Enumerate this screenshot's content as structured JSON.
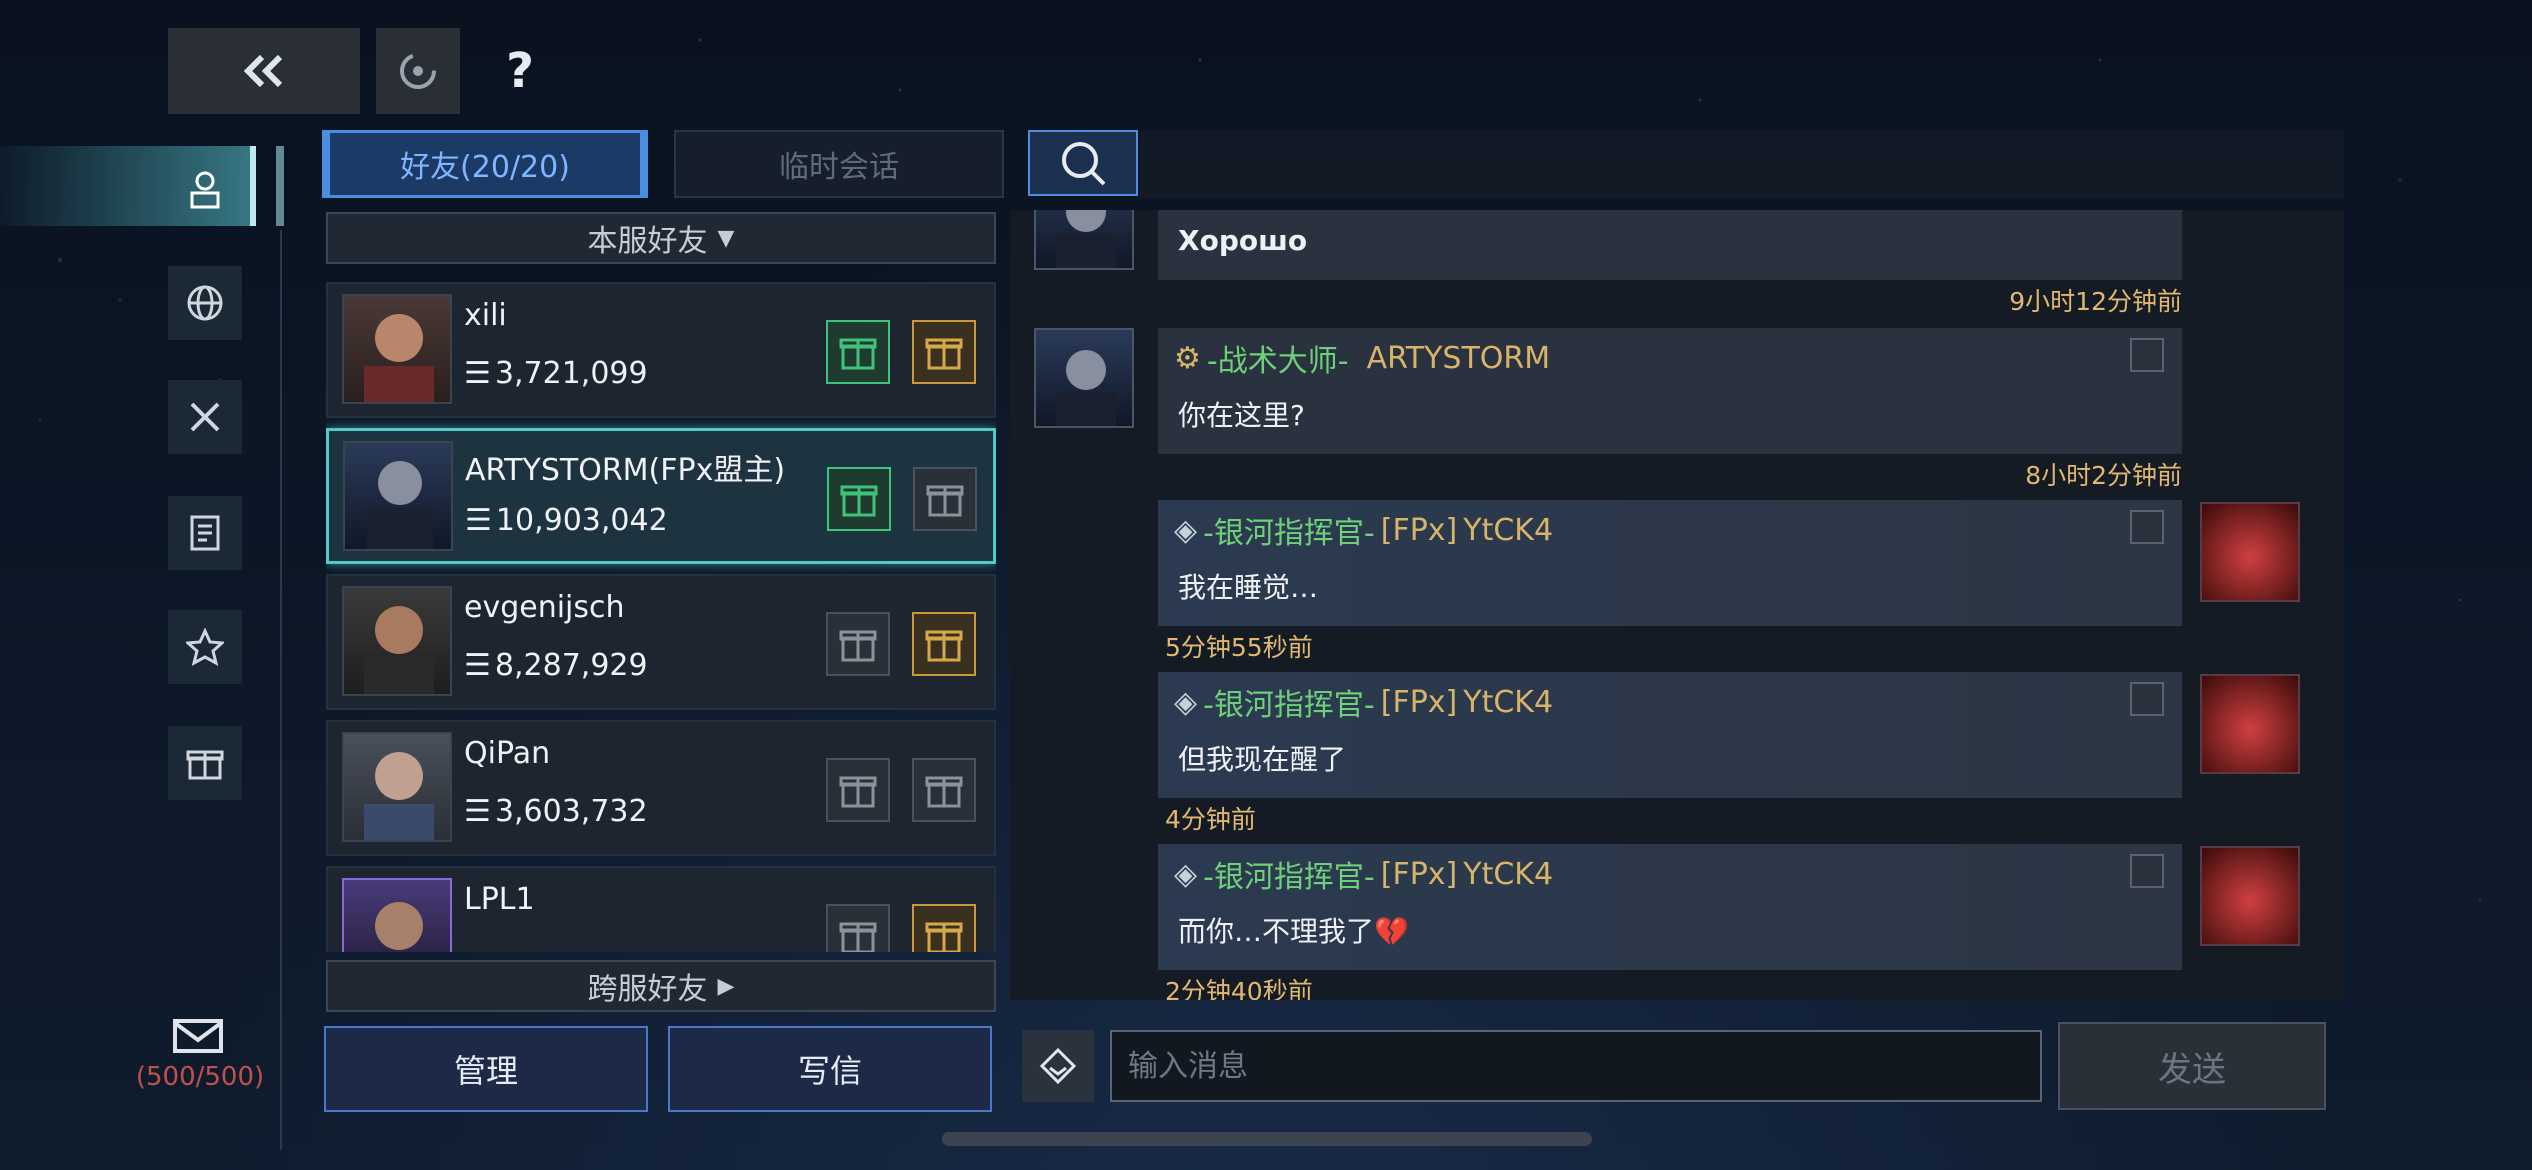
{
  "header": {
    "back_icon": "double-chevron-left-icon",
    "refresh_icon": "refresh-icon",
    "help_label": "?"
  },
  "rail": {
    "items": [
      {
        "icon": "person-icon",
        "active": true
      },
      {
        "icon": "globe-icon"
      },
      {
        "icon": "crossed-swords-icon"
      },
      {
        "icon": "document-icon"
      },
      {
        "icon": "star-icon"
      },
      {
        "icon": "gift-icon"
      }
    ],
    "mail_icon": "envelope-icon",
    "mail_count": "(500/500)"
  },
  "tabs": {
    "friends": "好友(20/20)",
    "temp_chat": "临时会话"
  },
  "friends": {
    "local_header": "本服好友",
    "cross_header": "跨服好友",
    "list": [
      {
        "name": "xili",
        "power": "3,721,099",
        "send_state": "active",
        "recv_state": "active"
      },
      {
        "name": "ARTYSTORM(FPx盟主)",
        "power": "10,903,042",
        "send_state": "active",
        "recv_state": "inactive",
        "selected": true
      },
      {
        "name": "evgenijsch",
        "power": "8,287,929",
        "send_state": "inactive",
        "recv_state": "active"
      },
      {
        "name": "QiPan",
        "power": "3,603,732",
        "send_state": "inactive",
        "recv_state": "inactive"
      },
      {
        "name": "LPL1",
        "power": "",
        "send_state": "inactive",
        "recv_state": "active"
      }
    ]
  },
  "buttons": {
    "manage": "管理",
    "write": "写信",
    "send": "发送"
  },
  "chat": {
    "messages": [
      {
        "side": "left",
        "text": "Хорошо",
        "time": "9小时12分钟前"
      },
      {
        "side": "left",
        "title": "-战术大师-",
        "name": "ARTYSTORM",
        "text": "你在这里?",
        "time": "8小时2分钟前"
      },
      {
        "side": "right",
        "title": "-银河指挥官-",
        "tag": "[FPx]",
        "name": "YtCK4",
        "text": "我在睡觉…",
        "time": "5分钟55秒前"
      },
      {
        "side": "right",
        "title": "-银河指挥官-",
        "tag": "[FPx]",
        "name": "YtCK4",
        "text": "但我现在醒了",
        "time": "4分钟前"
      },
      {
        "side": "right",
        "title": "-银河指挥官-",
        "tag": "[FPx]",
        "name": "YtCK4",
        "text": "而你…不理我了💔",
        "time": "2分钟40秒前"
      }
    ],
    "input_placeholder": "输入消息"
  },
  "colors": {
    "accent_blue": "#4a8ee0",
    "title_green": "#6fd07a",
    "timestamp_gold": "#e0b870",
    "mail_count_red": "#c0504d",
    "selected_teal": "#4fc9c9"
  }
}
